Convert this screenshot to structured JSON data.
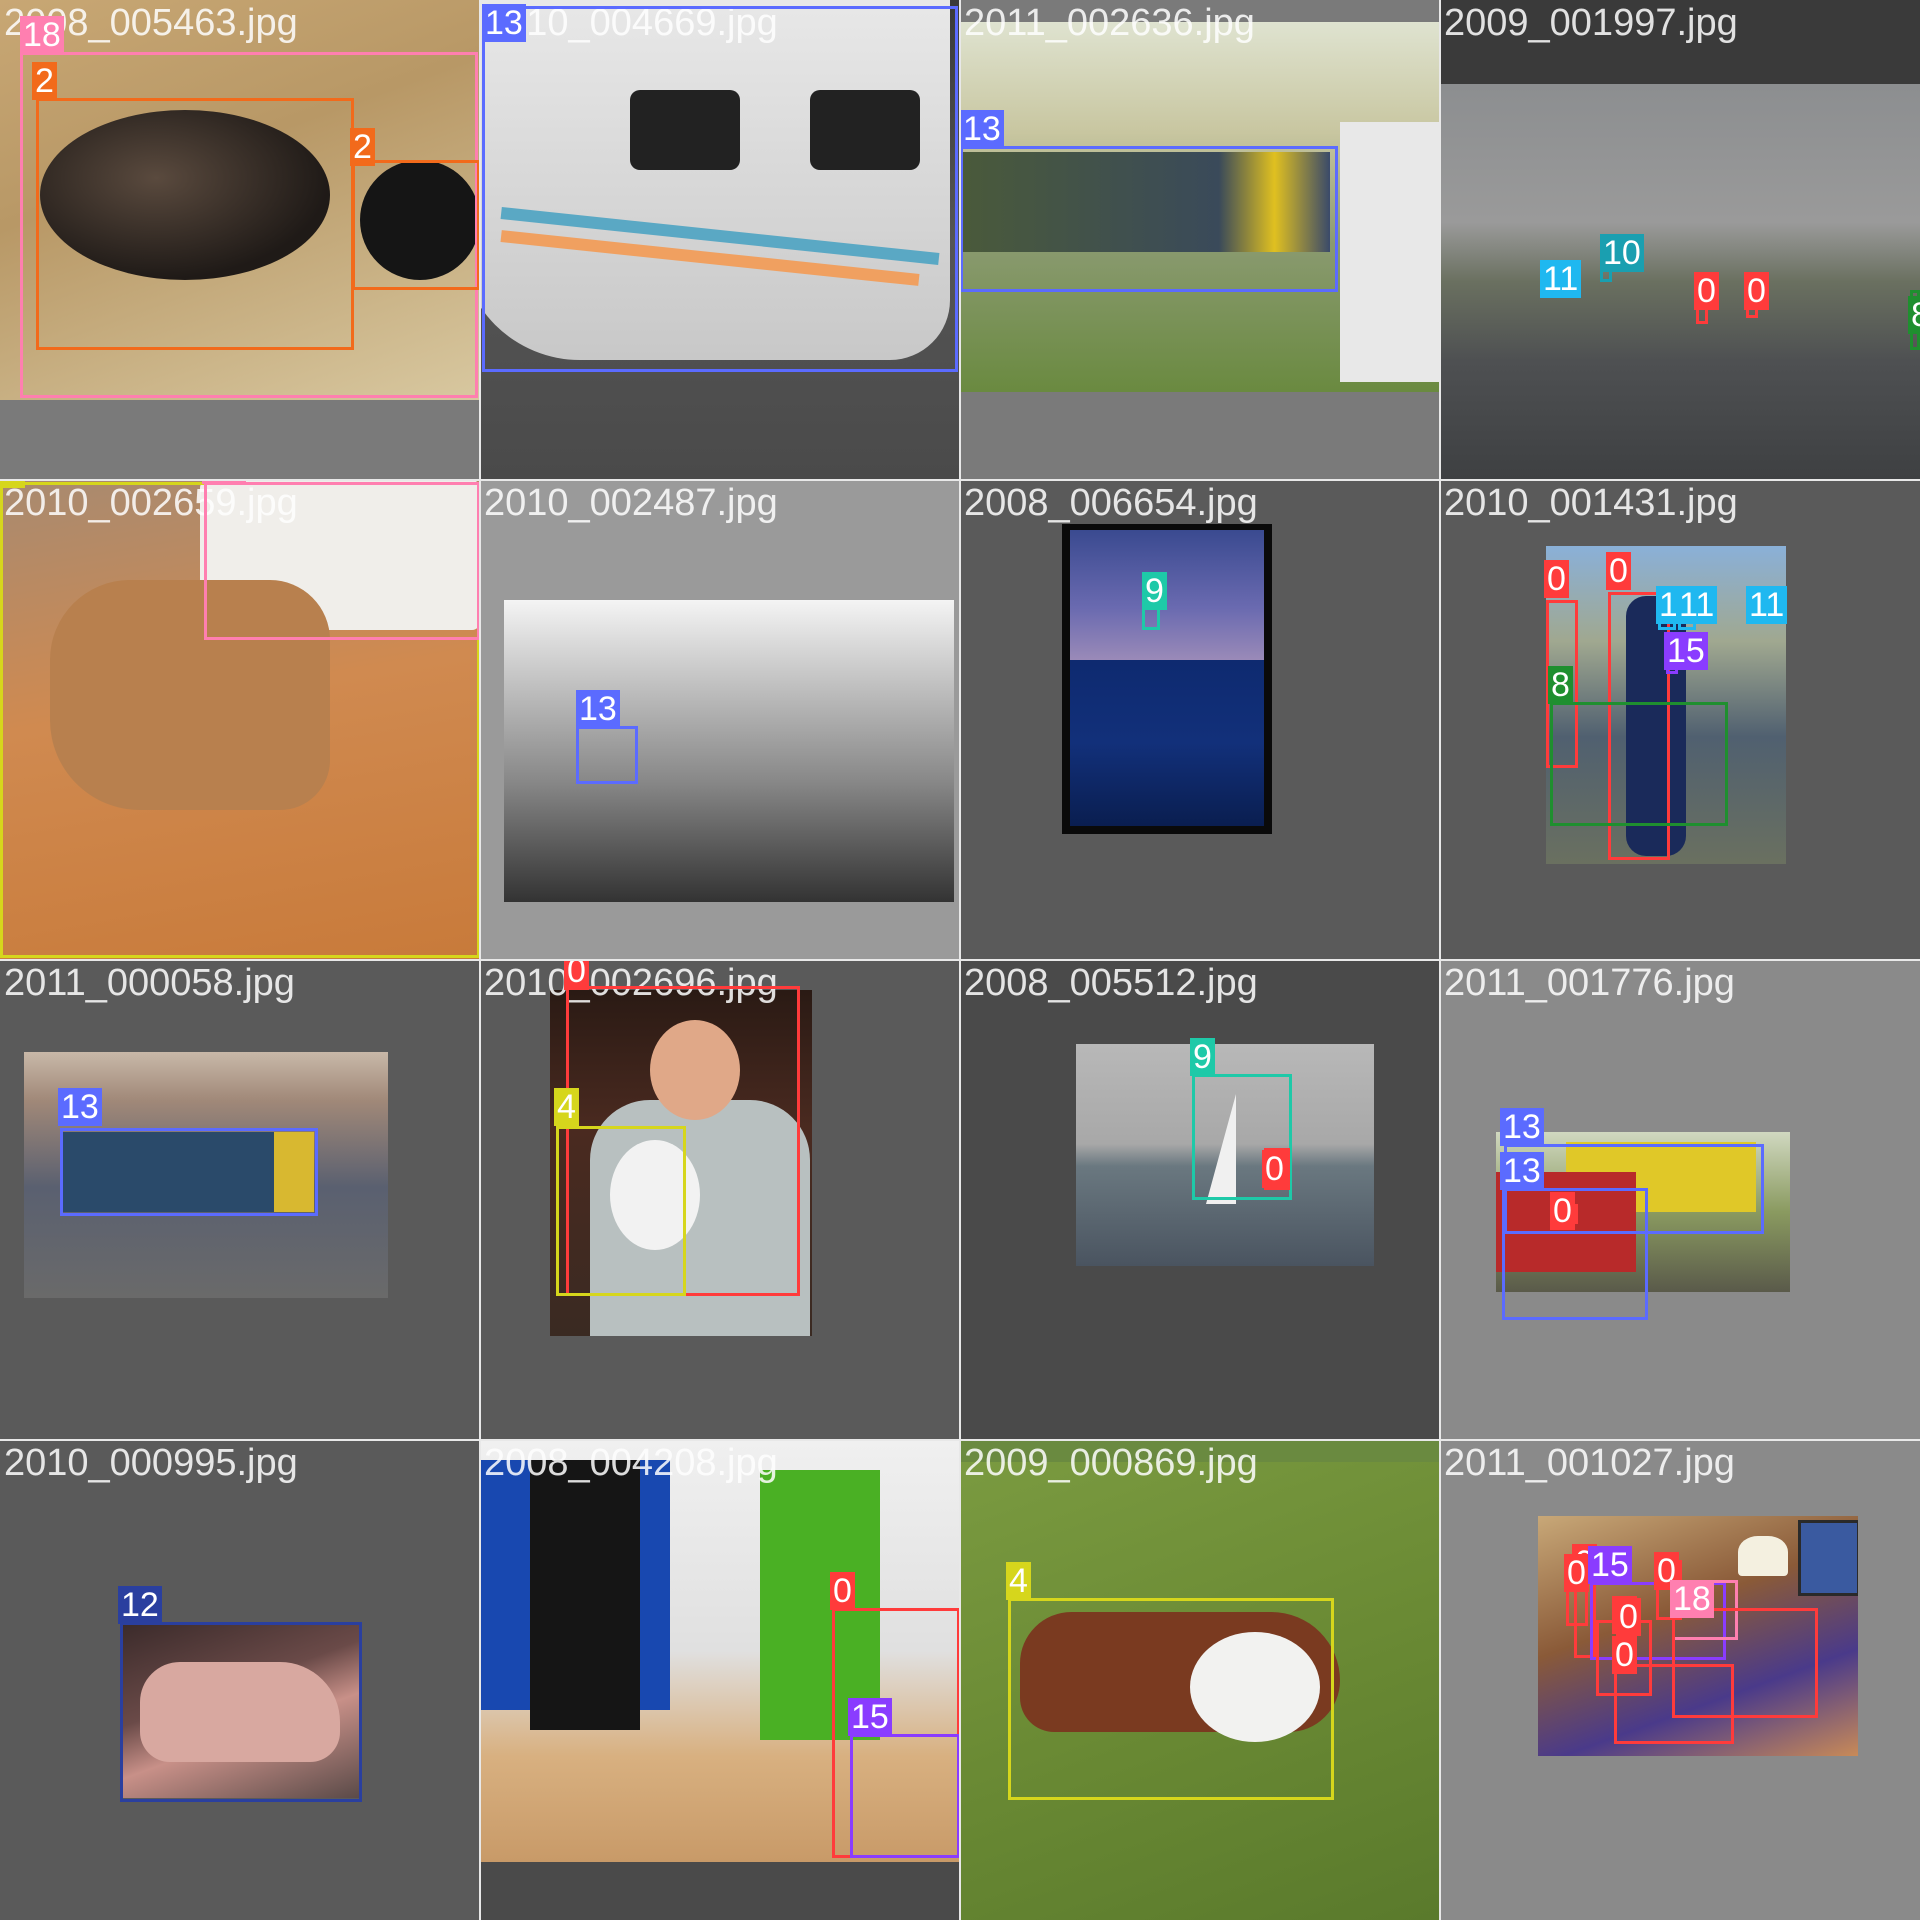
{
  "class_colors": {
    "0": "#ff3b3b",
    "2": "#f26a1b",
    "4": "#d6d61c",
    "8": "#1f8f2f",
    "9": "#1ec9a8",
    "10": "#1a9fb0",
    "11": "#1fb8f0",
    "12": "#2a3f9f",
    "13": "#5b6bff",
    "15": "#8a3cff",
    "18": "#ff7fb0"
  },
  "tiles": [
    {
      "filename": "2008_005463.jpg",
      "photo_desc": "cats-on-sofa",
      "boxes": [
        {
          "cls": "18",
          "label": "18"
        },
        {
          "cls": "2",
          "label": "2"
        },
        {
          "cls": "2",
          "label": "2"
        }
      ]
    },
    {
      "filename": "2010_004669.jpg",
      "photo_desc": "smt-maglev-train",
      "boxes": [
        {
          "cls": "13",
          "label": "13"
        }
      ]
    },
    {
      "filename": "2011_002636.jpg",
      "photo_desc": "csx-locomotive-at-station",
      "boxes": [
        {
          "cls": "13",
          "label": "13"
        }
      ]
    },
    {
      "filename": "2009_001997.jpg",
      "photo_desc": "street-with-traffic-lights",
      "boxes": [
        {
          "cls": "11",
          "label": "11"
        },
        {
          "cls": "10",
          "label": "10"
        },
        {
          "cls": "0",
          "label": "0"
        },
        {
          "cls": "0",
          "label": "0"
        },
        {
          "cls": "8",
          "label": "8"
        }
      ]
    },
    {
      "filename": "2010_002659.jpg",
      "photo_desc": "hairless-cat-in-sweater",
      "boxes": [
        {
          "cls": "4",
          "label": "4"
        },
        {
          "cls": "18",
          "label": "18"
        }
      ]
    },
    {
      "filename": "2010_002487.jpg",
      "photo_desc": "metro-station-bw",
      "boxes": [
        {
          "cls": "13",
          "label": "13"
        }
      ]
    },
    {
      "filename": "2008_006654.jpg",
      "photo_desc": "ocean-at-dusk",
      "boxes": [
        {
          "cls": "9",
          "label": "9"
        }
      ]
    },
    {
      "filename": "2010_001431.jpg",
      "photo_desc": "man-with-bicycle",
      "boxes": [
        {
          "cls": "0",
          "label": "0"
        },
        {
          "cls": "0",
          "label": "0"
        },
        {
          "cls": "11",
          "label": "11"
        },
        {
          "cls": "11",
          "label": "11"
        },
        {
          "cls": "11",
          "label": "11"
        },
        {
          "cls": "15",
          "label": "15"
        },
        {
          "cls": "8",
          "label": "8"
        }
      ]
    },
    {
      "filename": "2011_000058.jpg",
      "photo_desc": "blue-locomotive-rails",
      "boxes": [
        {
          "cls": "13",
          "label": "13"
        }
      ]
    },
    {
      "filename": "2010_002696.jpg",
      "photo_desc": "woman-holding-dog",
      "boxes": [
        {
          "cls": "0",
          "label": "0"
        },
        {
          "cls": "4",
          "label": "4"
        }
      ]
    },
    {
      "filename": "2008_005512.jpg",
      "photo_desc": "sailboat-on-sea",
      "boxes": [
        {
          "cls": "9",
          "label": "9"
        },
        {
          "cls": "0",
          "label": "0"
        }
      ]
    },
    {
      "filename": "2011_001776.jpg",
      "photo_desc": "two-locomotives",
      "boxes": [
        {
          "cls": "13",
          "label": "13"
        },
        {
          "cls": "13",
          "label": "13"
        },
        {
          "cls": "0",
          "label": "0"
        }
      ]
    },
    {
      "filename": "2010_000995.jpg",
      "photo_desc": "pink-motorcycle",
      "boxes": [
        {
          "cls": "12",
          "label": "12"
        }
      ]
    },
    {
      "filename": "2008_004208.jpg",
      "photo_desc": "office-with-green-wall",
      "boxes": [
        {
          "cls": "0",
          "label": "0"
        },
        {
          "cls": "15",
          "label": "15"
        }
      ]
    },
    {
      "filename": "2009_000869.jpg",
      "photo_desc": "bulldog-on-grass",
      "boxes": [
        {
          "cls": "4",
          "label": "4"
        }
      ]
    },
    {
      "filename": "2011_001027.jpg",
      "photo_desc": "people-in-living-room",
      "boxes": [
        {
          "cls": "0",
          "label": "0"
        },
        {
          "cls": "0",
          "label": "0"
        },
        {
          "cls": "15",
          "label": "15"
        },
        {
          "cls": "0",
          "label": "0"
        },
        {
          "cls": "0",
          "label": "0"
        },
        {
          "cls": "18",
          "label": "18"
        },
        {
          "cls": "0",
          "label": "0"
        },
        {
          "cls": "0",
          "label": "0"
        }
      ]
    }
  ]
}
